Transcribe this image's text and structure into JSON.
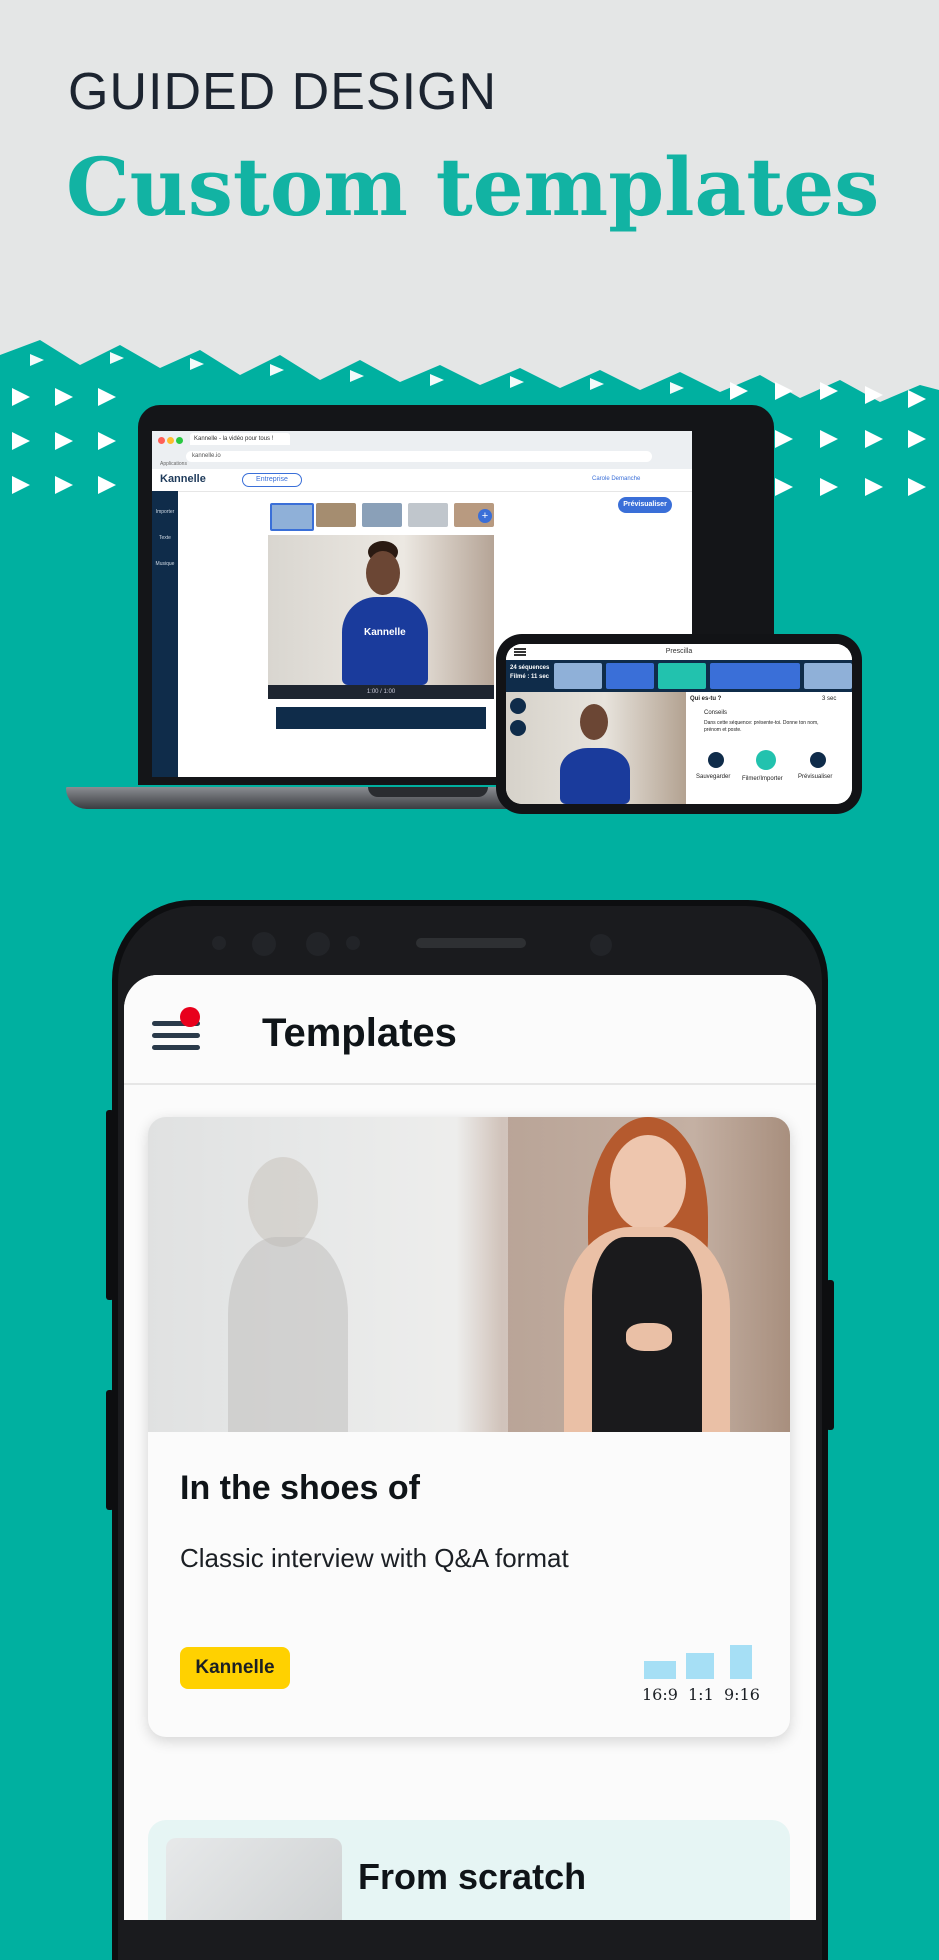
{
  "header": {
    "eyebrow": "GUIDED DESIGN",
    "headline": "Custom templates"
  },
  "laptop_screen": {
    "browser_tab": "Kannelle - la vidéo pour tous !",
    "url": "kannelle.io",
    "bookmark": "Applications",
    "app_logo": "Kannelle",
    "workspace_pill": "Entreprise",
    "user_name": "Carole Demanche",
    "preview_button": "Prévisualiser",
    "sidebar": [
      "Importer",
      "Texte",
      "Musique"
    ],
    "video_overlay_logo": "Kannelle",
    "timecode": "1:00 / 1:00"
  },
  "mini_phone": {
    "title": "Prescilla",
    "sequences": "24 séquences",
    "filmed": "Filmé : 11 sec",
    "question": "Qui es-tu ?",
    "timer": "3 sec",
    "tips_label": "Conseils",
    "tips_text": "Dans cette séquence: présente-toi. Donne ton nom, prénom et poste.",
    "actions": [
      "Sauvegarder",
      "Filmer/Importer",
      "Prévisualiser"
    ]
  },
  "app_screen": {
    "title": "Templates",
    "cards": [
      {
        "title": "In the shoes of",
        "description": "Classic interview with Q&A format",
        "badge": "Kannelle",
        "ratios": [
          "16:9",
          "1:1",
          "9:16"
        ]
      },
      {
        "title": "From scratch"
      }
    ]
  },
  "colors": {
    "brand_teal": "#00b0a0",
    "headline_teal": "#12b3a3",
    "badge_yellow": "#ffd100",
    "ratio_blue": "#a6dff5",
    "notification_red": "#e8001c",
    "accent_blue": "#3a6fd8"
  },
  "icons": [
    "hamburger-menu-icon",
    "notification-dot-icon",
    "plus-icon",
    "record-icon",
    "save-icon",
    "next-icon"
  ]
}
